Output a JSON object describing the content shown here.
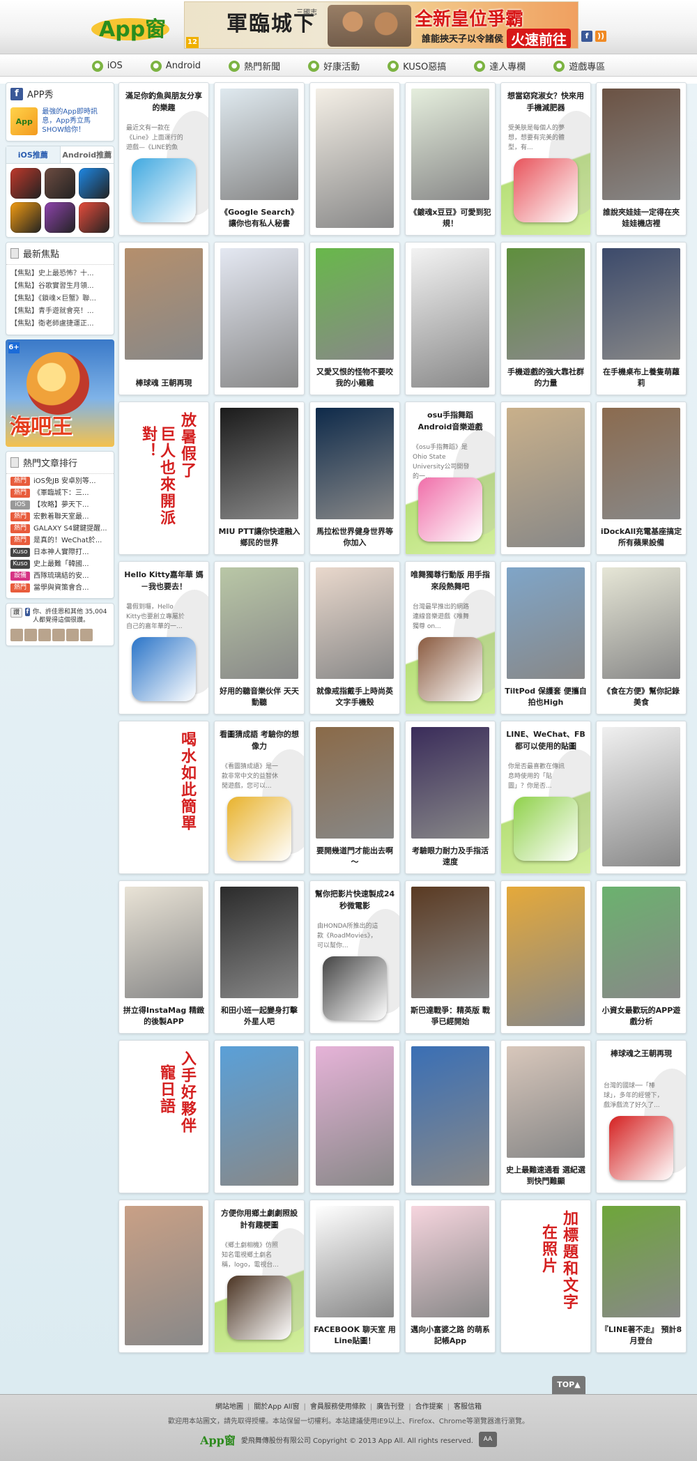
{
  "header": {
    "logo_text": "App窗",
    "banner": {
      "title_left": "軍臨城下",
      "title_sub": "三國志",
      "age": "12",
      "title_right": "全新皇位爭霸",
      "slogan": "誰能挾天子以令諸侯",
      "cta": "火速前往"
    },
    "social": [
      "f",
      "rss"
    ]
  },
  "nav": [
    {
      "label": "iOS",
      "icon": "apple-icon",
      "color": "#7cb342"
    },
    {
      "label": "Android",
      "icon": "android-icon",
      "color": "#7cb342"
    },
    {
      "label": "熱門新聞",
      "icon": "news-icon",
      "color": "#7cb342"
    },
    {
      "label": "好康活動",
      "icon": "gift-icon",
      "color": "#7cb342"
    },
    {
      "label": "KUSO惡搞",
      "icon": "kuso-icon",
      "color": "#7cb342"
    },
    {
      "label": "達人專欄",
      "icon": "pen-icon",
      "color": "#7cb342"
    },
    {
      "label": "遊戲專區",
      "icon": "game-icon",
      "color": "#7cb342"
    }
  ],
  "sidebar": {
    "appshow": {
      "title": "APP秀",
      "text": "最強的App即時訊息，App秀立馬SHOW給你！"
    },
    "tabs": [
      "iOS推薦",
      "Android推薦"
    ],
    "app_colors": [
      "#c0392b",
      "#6d4c41",
      "#1e88e5",
      "#f39c12",
      "#8e44ad",
      "#e74c3c"
    ],
    "news": {
      "title": "最新焦點",
      "items": [
        "【焦點】史上最恐怖？十...",
        "【焦點】谷歌實習生月領...",
        "【焦點】《鎖魂×巨蟹》聯...",
        "【焦點】青手遊就會亮！...",
        "【焦點】衛老師盧捷運正..."
      ]
    },
    "ad": {
      "age": "6+",
      "title": "海吧王"
    },
    "hot": {
      "title": "熱門文章排行",
      "items": [
        {
          "tag": "熱門",
          "color": "#e85c3c",
          "text": "iOS免JB 安卓別等..."
        },
        {
          "tag": "熱門",
          "color": "#e85c3c",
          "text": "《軍臨城下：三..."
        },
        {
          "tag": "iOS",
          "color": "#999999",
          "text": "【攻略】夢天下..."
        },
        {
          "tag": "熱門",
          "color": "#e85c3c",
          "text": "宏數着聯天室最..."
        },
        {
          "tag": "熱門",
          "color": "#e85c3c",
          "text": "GALAXY S4鍵鍵提醒..."
        },
        {
          "tag": "熱門",
          "color": "#e85c3c",
          "text": "是真的！WeChat於..."
        },
        {
          "tag": "Kuso",
          "color": "#444444",
          "text": "日本神人實際打..."
        },
        {
          "tag": "Kuso",
          "color": "#444444",
          "text": "史上最難「韓國..."
        },
        {
          "tag": "設備",
          "color": "#d63384",
          "text": "西隊琉璃結的安..."
        },
        {
          "tag": "熱門",
          "color": "#e85c3c",
          "text": "當學與資策會合..."
        }
      ]
    },
    "like": {
      "button": "讚",
      "text": "你、許佳恩和其他 35,004 人都覺得這個很讚。"
    }
  },
  "cards": [
    {
      "type": "text",
      "style": "plain",
      "head": "滿足你釣魚與朋友分享的樂趣",
      "body": "最近文有一款在《Line》上面運行的遊戲—《LINE釣魚",
      "icon_color": "#3fa8e0"
    },
    {
      "type": "image",
      "caption": "《Google Search》讓你也有私人秘書",
      "img": "#dfe9ef"
    },
    {
      "type": "image",
      "caption": "",
      "img": "#f4efe6"
    },
    {
      "type": "image",
      "caption": "《鍍魂x豆豆》可愛到犯規！",
      "img": "#e5eedd"
    },
    {
      "type": "text",
      "style": "green",
      "head": "想當窈窕淑女？快來用手機減肥器",
      "body": "受美肤是每個人的夢想，想要有完美的體型，有...",
      "icon_color": "#e8535b"
    },
    {
      "type": "image",
      "caption": "誰說夾娃娃一定得在夾娃娃機店裡",
      "img": "#6b5243"
    },
    {
      "type": "image",
      "caption": "棒球魂 王朝再現",
      "img": "#b58f6c"
    },
    {
      "type": "image",
      "caption": "",
      "img": "#e4e8f2"
    },
    {
      "type": "image",
      "caption": "又愛又恨的怪物不要咬我的小雞雞",
      "img": "#68b84a"
    },
    {
      "type": "image",
      "caption": "",
      "img": "#f3f3f3"
    },
    {
      "type": "image",
      "caption": "手機遊戲的強大靠社群的力量",
      "img": "#5f8f3d"
    },
    {
      "type": "image",
      "caption": "在手機桌布上養隻萌蘿莉",
      "img": "#3c4a6b"
    },
    {
      "type": "vert",
      "lines": [
        "放暑假了",
        "巨人也來開派對！"
      ]
    },
    {
      "type": "image",
      "caption": "MIU PTT讓你快速融入鄉民的世界",
      "img": "#1b1b1b"
    },
    {
      "type": "image",
      "caption": "馬拉松世界健身世界等你加入",
      "img": "#0e2a4a"
    },
    {
      "type": "text",
      "style": "green",
      "head": "osu手指舞蹈 Android音樂遊戲",
      "body": "《osu手指舞蹈》是Ohio State University公司開發的一...",
      "icon_color": "#f06ea9"
    },
    {
      "type": "image",
      "caption": "",
      "img": "#c9b08a"
    },
    {
      "type": "image",
      "caption": "iDockAll充電基座搞定所有蘋果設備",
      "img": "#8b6b4f"
    },
    {
      "type": "text",
      "style": "plain",
      "head": "Hello Kitty嘉年華 媽－我也要去！",
      "body": "暑假到囉，Hello Kitty也要創立專屬於自己的嘉年華的一...",
      "icon_color": "#2a74c8"
    },
    {
      "type": "image",
      "caption": "好用的聽音樂伙伴 天天動聽",
      "img": "#b9c7a6"
    },
    {
      "type": "image",
      "caption": "就像戒指戴手上時尚英文字手機殼",
      "img": "#e9d8cc"
    },
    {
      "type": "text",
      "style": "green",
      "head": "唯舞獨尊行動版 用手指來段熱舞吧",
      "body": "台灣最早推出的網路連線音樂遊戲《唯舞獨尊 on...",
      "icon_color": "#8a5a3f"
    },
    {
      "type": "image",
      "caption": "TiltPod 保護套 便攜自拍也High",
      "img": "#7fa5c8"
    },
    {
      "type": "image",
      "caption": "《食在方便》幫你記錄美食",
      "img": "#e6e6d6"
    },
    {
      "type": "vert",
      "lines": [
        "喝水如此簡單"
      ]
    },
    {
      "type": "text",
      "style": "plain",
      "head": "看圖猜成語 考驗你的想像力",
      "body": "《看圖猜成語》是一款非常中文的益智休閒遊戲，您可以...",
      "icon_color": "#e8b22c"
    },
    {
      "type": "image",
      "caption": "要開幾道門才能出去啊～",
      "img": "#8a6a48"
    },
    {
      "type": "image",
      "caption": "考驗眼力耐力及手指活速度",
      "img": "#3a2c5a"
    },
    {
      "type": "text",
      "style": "green",
      "head": "LINE、WeChat、FB 都可以使用的貼圖",
      "body": "你是否最喜歡在傳訊息時使用的「貼圖」？你是否...",
      "icon_color": "#8fd14a"
    },
    {
      "type": "image",
      "caption": "",
      "img": "#f0f0f0"
    },
    {
      "type": "image",
      "caption": "拼立得InstaMag 精緻的後製APP",
      "img": "#e9e3d6"
    },
    {
      "type": "image",
      "caption": "和田小班一起變身打擊外星人吧",
      "img": "#2b2b2b"
    },
    {
      "type": "text",
      "style": "plain",
      "head": "幫你把影片快速製成24秒微電影",
      "body": "由HONDA所推出的這款《RoadMovies》，可以幫你...",
      "icon_color": "#444444"
    },
    {
      "type": "image",
      "caption": "斯巴達戰爭：精英版 戰爭已經開始",
      "img": "#5a3a22"
    },
    {
      "type": "image",
      "caption": "",
      "img": "#e5a93a"
    },
    {
      "type": "image",
      "caption": "小資女最歡玩的APP遊戲分析",
      "img": "#6bb26e"
    },
    {
      "type": "vert",
      "lines": [
        "入手好夥伴",
        "寵日語"
      ]
    },
    {
      "type": "image",
      "caption": "",
      "img": "#5aa0d8"
    },
    {
      "type": "image",
      "caption": "",
      "img": "#e6b3d8"
    },
    {
      "type": "image",
      "caption": "",
      "img": "#3a6fb5"
    },
    {
      "type": "image",
      "caption": "史上最難速通看 選紀選到快門難顯",
      "img": "#d8c7bb"
    },
    {
      "type": "text",
      "style": "plain",
      "head": "棒球魂之王朝再現",
      "body": "台灣的國球──「棒球」，多年的經營下，戲淨戲流了好久了...",
      "icon_color": "#d42020"
    },
    {
      "type": "image",
      "caption": "",
      "img": "#c9a086"
    },
    {
      "type": "text",
      "style": "green",
      "head": "方便你用鄉土劇劇照設計有趣梗圖",
      "body": "《鄉土劇相機》仿照知名電視鄉土劇名稱，logo，電視台...",
      "icon_color": "#4a3322"
    },
    {
      "type": "image",
      "caption": "FACEBOOK 聊天室 用Line貼圖！",
      "img": "#ffffff"
    },
    {
      "type": "image",
      "caption": "邁向小富婆之路 的萌系記帳App",
      "img": "#f6d5de"
    },
    {
      "type": "vert",
      "lines": [
        "加標題和文字",
        "在照片"
      ]
    },
    {
      "type": "image",
      "caption": "『LINE著不走』 預計8月登台",
      "img": "#6ea63a"
    }
  ],
  "footer": {
    "links": [
      "網站地圖",
      "關於App All窗",
      "會員服務使用條款",
      "廣告刊登",
      "合作提案",
      "客服信箱"
    ],
    "note": "歡迎用本站圖文，請先取得授權。本站保留一切權利。本站建議使用IE9以上、Firefox、Chrome等瀏覽器進行瀏覽。",
    "logo": "App窗",
    "copyright": "愛飛舞傳股份有限公司 Copyright © 2013 App All. All rights reserved.",
    "top": "TOP▲"
  }
}
